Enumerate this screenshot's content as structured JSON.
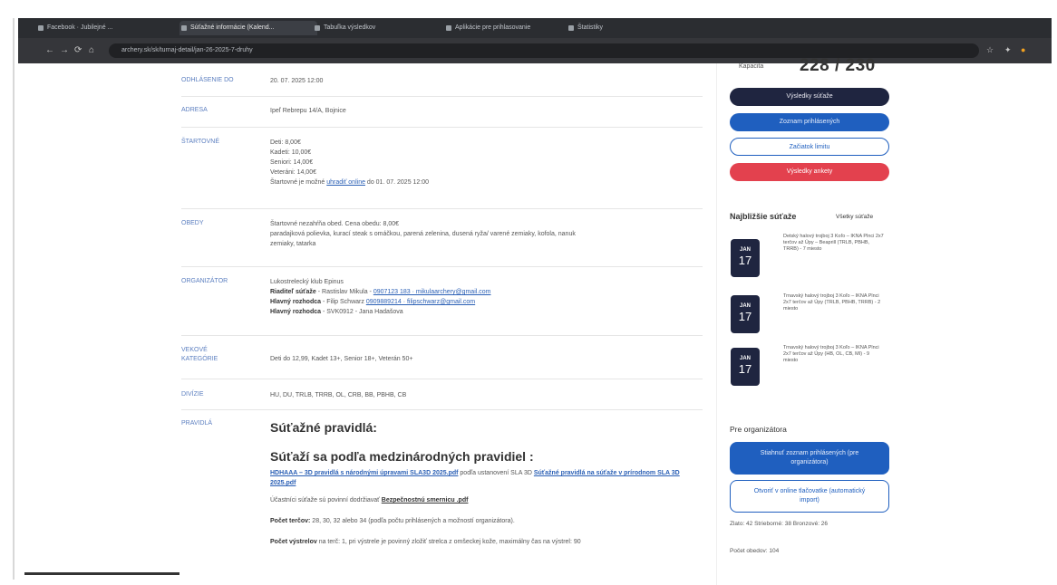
{
  "browser": {
    "tabs": [
      {
        "label": "Facebook · Jubilejné ...",
        "active": false
      },
      {
        "label": "Súťažné informácie (Kalend...",
        "active": true
      },
      {
        "label": "Tabuľka výsledkov",
        "active": false
      },
      {
        "label": "Aplikácie pre prihlasovanie",
        "active": false
      },
      {
        "label": "Štatistiky",
        "active": false
      }
    ],
    "url": "archery.sk/sk/turnaj-detail/jan-26-2025-7-druhy",
    "nav": {
      "back": "←",
      "forward": "→",
      "reload": "⟳",
      "home": "⌂"
    },
    "right_icons": [
      "star-icon",
      "extensions-icon",
      "profile-icon"
    ]
  },
  "details": {
    "rows": [
      {
        "label": "Odhlásenie do",
        "lines": [
          "20. 07. 2025 12:00"
        ]
      },
      {
        "label": "Adresa",
        "lines": [
          "Ipeľ Rebrepu 14/A, Bojnice"
        ]
      },
      {
        "label": "Štartovné",
        "lines": [
          "Deti: 8,00€",
          "Kadeti: 10,00€",
          "Seniori: 14,00€",
          "Veteráni: 14,00€"
        ],
        "note_prefix": "Štartovné je možné ",
        "note_link": "uhradiť online",
        "note_suffix": " do 01. 07. 2025 12:00"
      },
      {
        "label": "Obedy",
        "lines": [
          "Štartovné nezahŕňa obed. Cena obedu: 8,00€",
          "paradajková polievka, kurací steak s omáčkou, parená zelenina, dusená ryža/ varené zemiaky, kofola, nanuk",
          "zemiaky, tatarka"
        ]
      },
      {
        "label": "Organizátor",
        "org": "Lukostrelecký klub Epinus",
        "lines_rich": [
          {
            "bold": "Riaditeľ súťaže",
            "text": " - Rastislav Mikula - ",
            "link": "0907123 183 · mikulaarchery@gmail.com"
          },
          {
            "bold": "Hlavný rozhodca",
            "text": " - Filip Schwarz ",
            "link": "0909889214 · filipschwarz@gmail.com"
          },
          {
            "bold": "Hlavný rozhodca",
            "text": " - SVK0912 - Jana Hadašova",
            "link": ""
          }
        ]
      },
      {
        "label": "Vekové kategórie",
        "lines": [
          "Deti do 12,99, Kadet 13+, Senior 18+, Veterán 50+"
        ]
      },
      {
        "label": "Divízie",
        "lines": [
          "HU, DU, TRLB, TRRB, OL, CRB, BB, PBHB, CB"
        ]
      },
      {
        "label": "Pravidlá",
        "heading1": "Súťažné pravidlá:",
        "heading2": "Súťaží sa podľa medzinárodných pravidiel :",
        "rule_link1": "HDHAAA – 3D pravidlá s národnými úpravami SLA3D 2025.pdf",
        "rule_text1": " podľa ustanovení SLA 3D ",
        "rule_link2": "Súťažné pravidlá na súťaže v prírodnom SLA 3D 2025.pdf",
        "safety_prefix": "Účastníci súťaže sú povinní dodržiavať ",
        "safety_link": "Bezpečnostnú smernicu .pdf",
        "targets_bold": "Počet terčov:",
        "targets_text": " 28, 30, 32 alebo 34 (podľa počtu prihlásených a možností organizátora).",
        "shots_bold": "Počet výstrelov",
        "shots_text": " na terč: 1, pri výstrele je povinný zložiť strelca z omšeckej kože, maximálny čas na výstrel: 90"
      }
    ]
  },
  "sidebar": {
    "capacity_label": "Kapacita",
    "capacity_value": "228 / 230",
    "buttons": [
      "Výsledky súťaže",
      "Zoznam prihlásených",
      "Začiatok limitu",
      "Výsledky ankety"
    ],
    "nearest_title": "Najbližšie súťaže",
    "all_link": "Všetky súťaže",
    "events": [
      {
        "month": "JAN",
        "day": "17",
        "text": "Detský halový trojboj 3 Koľo – IKNA Plnci 2x7 terčov až Úpy – Beaprill (TRLB, PBHB, TRRB) - 7 miesto"
      },
      {
        "month": "JAN",
        "day": "17",
        "text": "Trnavský halový trojboj 3 Koľo – IKNA Plnci 2x7 terčov až Úpy (TRLB, PBHB, TRRB) - 2 miesto"
      },
      {
        "month": "JAN",
        "day": "17",
        "text": "Trnavský halový trojboj 3 Koľo – IKNA Plnci 2x7 terčov až Úpy (HB, OL, CB, MI) - 9 miesto"
      }
    ],
    "org_title": "Pre organizátora",
    "org_btn1": "Stiahnuť zoznam prihlásených (pre organizátora)",
    "org_btn2": "Otvoriť v online tlačovatke (automatický import)",
    "medals": "Zlato: 42   Strieborné: 38   Bronzové: 26",
    "lunch_count": "Počet obedov: 104"
  }
}
